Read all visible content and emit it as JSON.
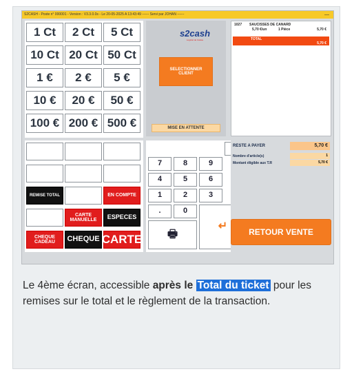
{
  "window": {
    "title": "S2CASH - Poste n° 000001 - Version : V3.3.0.0s - Le 20-05-2025 A 13:43:49 ------ Servi par JOHAN ------",
    "minimize": "—"
  },
  "coins": {
    "row1": [
      "1 Ct",
      "2 Ct",
      "5 Ct"
    ],
    "row2": [
      "10 Ct",
      "20 Ct",
      "50 Ct"
    ],
    "row3": [
      "1 €",
      "2 €",
      "5 €"
    ],
    "row4": [
      "10 €",
      "20 €",
      "50 €"
    ],
    "row5": [
      "100 €",
      "200 €",
      "500 €"
    ]
  },
  "payment": {
    "remise_total": "REMISE TOTAL",
    "en_compte": "EN COMPTE",
    "carte_manuelle": "CARTE MANUELLE",
    "especes": "ESPECES",
    "cheque_cadeau": "CHEQUE CADEAU",
    "cheque": "CHEQUE",
    "carte": "CARTE"
  },
  "middle": {
    "logo": "s2cash",
    "logo_tagline": "Logiciel de Caisse",
    "select_client": "SELECTIONNER CLIENT",
    "hold": "MISE EN ATTENTE"
  },
  "keypad": {
    "keys": [
      "7",
      "8",
      "9",
      "4",
      "5",
      "6",
      "1",
      "2",
      "3",
      ".",
      "0"
    ],
    "delete_icon": "trash-icon",
    "print_icon": "printer-icon",
    "enter_icon": "enter-arrow-icon"
  },
  "ticket": {
    "line_code": "1027",
    "line_name": "SAUCISSES DE CANARD",
    "line_price": "5,70 €/un",
    "line_qty": "1 Pièce",
    "line_total": "5,70 €",
    "total_label": "TOTAL",
    "total_value": "5,70 €"
  },
  "summary": {
    "reste_label": "RESTE A PAYER",
    "reste_value": "5,70 €",
    "articles_label": "Nombre d'article(s)",
    "articles_value": "1",
    "tr_label": "Montant éligible aux T.R",
    "tr_value": "5,70 €"
  },
  "retour_vente": "RETOUR VENTE",
  "caption": {
    "p1": "Le 4ème écran, accessible ",
    "bold": "après le ",
    "highlight": "Total du ticket",
    "p2": " pour les remises sur le total et le règlement de la transaction."
  },
  "colors": {
    "accent_orange": "#f47b20",
    "titlebar_yellow": "#f7c928",
    "red": "#e11d1d",
    "highlight_blue": "#1e6fd9"
  }
}
